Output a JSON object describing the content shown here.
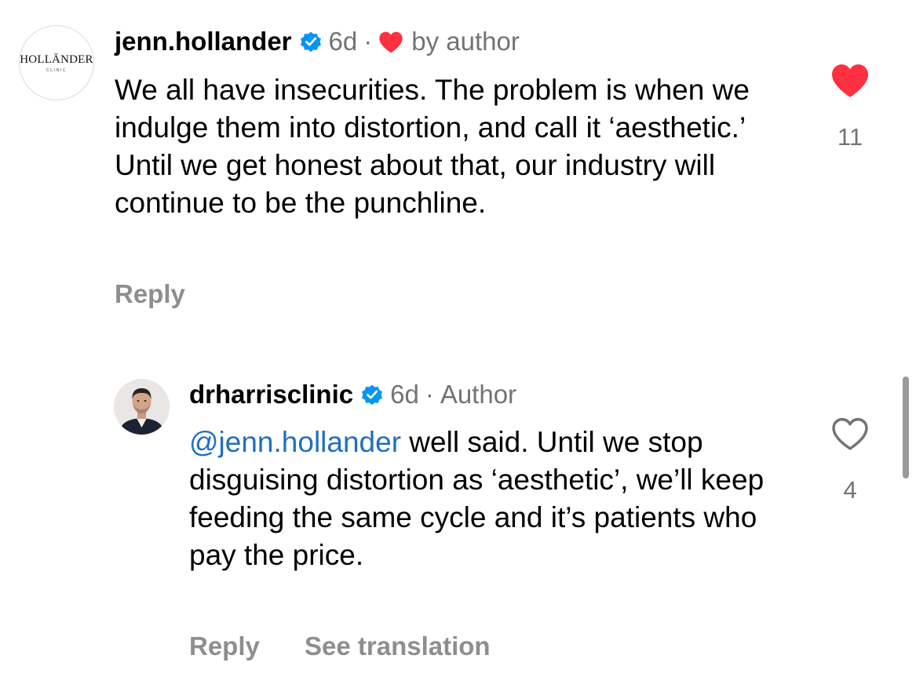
{
  "comments": [
    {
      "avatar": {
        "logo_main": "HOLLĀNDER",
        "logo_sub": "CLINIC"
      },
      "username": "jenn.hollander",
      "verified_icon": "verified-badge-icon",
      "time": "6d",
      "separator": "·",
      "liked_by_author_icon": "heart-filled-icon",
      "liked_by_author_label": "by author",
      "text": "We all have insecurities. The problem is when we indulge them into distortion, and call it ‘aesthetic.’ Until we get honest about that, our industry will continue to be the punchline.",
      "reply_label": "Reply",
      "like_icon": "heart-filled-icon",
      "liked": true,
      "like_count": "11"
    },
    {
      "avatar_icon": "profile-photo",
      "username": "drharrisclinic",
      "verified_icon": "verified-badge-icon",
      "time": "6d",
      "separator": "·",
      "author_label": "Author",
      "mention": "@jenn.hollander",
      "text_after_mention": " well said. Until we stop disguising distortion as ‘aesthetic’, we’ll keep feeding the same cycle and it’s patients who pay the price.",
      "reply_label": "Reply",
      "see_translation_label": "See translation",
      "like_icon": "heart-outline-icon",
      "liked": false,
      "like_count": "4"
    }
  ],
  "colors": {
    "like_red": "#ff3040",
    "verified_blue": "#0095f6",
    "mention_blue": "#1f6fc1",
    "meta_gray": "#737373",
    "action_gray": "#8e8e8e"
  }
}
